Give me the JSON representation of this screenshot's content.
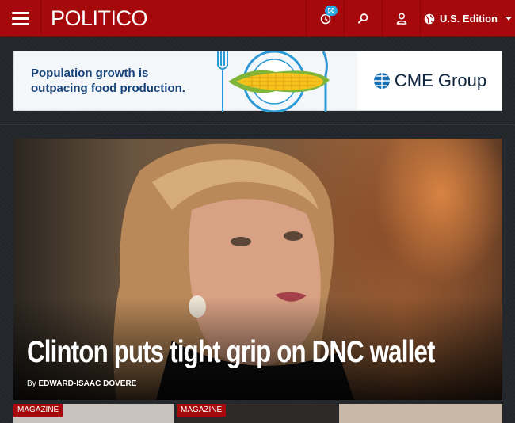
{
  "header": {
    "logo": "POLITICO",
    "history_count": "50",
    "edition_label": "U.S. Edition"
  },
  "ad": {
    "headline": "Population growth is outpacing food production.",
    "brand": "CME Group"
  },
  "hero": {
    "headline": "Clinton puts tight grip on DNC wallet",
    "byline_prefix": "By",
    "author": "EDWARD-ISAAC DOVERE"
  },
  "cards": [
    {
      "tag": "MAGAZINE"
    },
    {
      "tag": "MAGAZINE"
    },
    {
      "tag": ""
    }
  ],
  "colors": {
    "brand_red": "#a6090c",
    "badge_blue": "#2aa7e8",
    "ad_text_blue": "#16427a"
  },
  "icons": {
    "menu": "hamburger-icon",
    "history": "clock-icon",
    "search": "search-icon",
    "user": "user-icon",
    "edition": "globe-icon"
  }
}
